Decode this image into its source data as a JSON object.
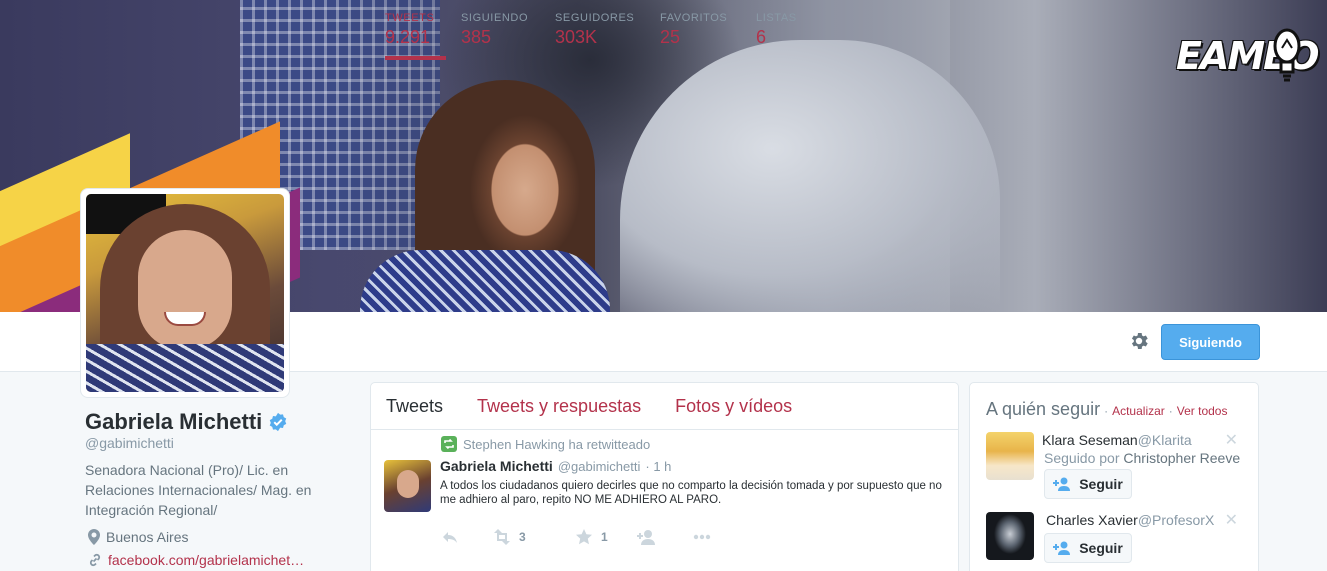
{
  "banner": {
    "logo_text": "EAMEO"
  },
  "nav": {
    "stats": [
      {
        "label": "TWEETS",
        "value": "9.291",
        "active": true
      },
      {
        "label": "SIGUIENDO",
        "value": "385",
        "active": false
      },
      {
        "label": "SEGUIDORES",
        "value": "303K",
        "active": false
      },
      {
        "label": "FAVORITOS",
        "value": "25",
        "active": false
      },
      {
        "label": "LISTAS",
        "value": "6",
        "active": false
      }
    ],
    "follow_button": "Siguiendo"
  },
  "profile": {
    "name": "Gabriela Michetti",
    "handle": "@gabimichetti",
    "bio": "Senadora Nacional (Pro)/ Lic. en Relaciones Internacionales/ Mag. en Integración Regional/",
    "location": "Buenos Aires",
    "link": "facebook.com/gabrielamichet…"
  },
  "timeline": {
    "tabs": [
      "Tweets",
      "Tweets y respuestas",
      "Fotos y vídeos"
    ],
    "tweet": {
      "retweeted_by": "Stephen Hawking ha retwitteado",
      "author_name": "Gabriela Michetti",
      "author_handle": "@gabimichetti",
      "time": "· 1 h",
      "text": "A todos los ciudadanos quiero decirles que no comparto la decisión tomada y por supuesto que no me adhiero al paro, repito NO ME ADHIERO AL PARO.",
      "retweet_count": "3",
      "favorite_count": "1"
    }
  },
  "who_to_follow": {
    "title": "A quién seguir",
    "refresh": "Actualizar",
    "view_all": "Ver todos",
    "suggestions": [
      {
        "name": "Klara Seseman",
        "handle": "@Klarita",
        "followed_by_label": "Seguido por",
        "followed_by": "Christopher Reeve",
        "button": "Seguir"
      },
      {
        "name": "Charles Xavier",
        "handle": "@ProfesorX",
        "button": "Seguir"
      }
    ]
  },
  "colors": {
    "accent": "#b3324b",
    "follow_blue": "#55acee",
    "muted": "#8899a6",
    "retweet_green": "#5ab15a"
  }
}
